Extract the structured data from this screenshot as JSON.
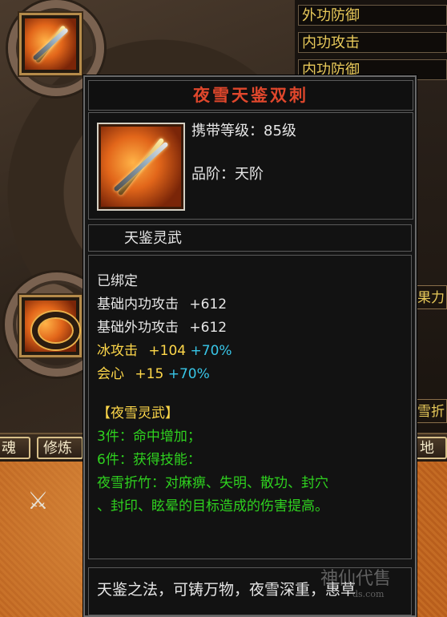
{
  "background": {
    "stat_rows": [
      "外功防御",
      "内功攻击",
      "内功防御"
    ],
    "right_tab_top": "果力",
    "right_tab_mid": "雪折",
    "right_tab_bottom": "地",
    "bottom_tabs": [
      "魂",
      "修炼"
    ]
  },
  "tooltip": {
    "title": "夜雪天鉴双刺",
    "carry_level": "携带等级：85级",
    "grade": "品阶：天阶",
    "category": "天鉴灵武",
    "bound": "已绑定",
    "stats": [
      {
        "label": "基础内功攻击",
        "value": "+612",
        "extra": ""
      },
      {
        "label": "基础外功攻击",
        "value": "+612",
        "extra": ""
      },
      {
        "label": "冰攻击",
        "value": "+104",
        "extra": "+70%"
      },
      {
        "label": "会心",
        "value": "+15",
        "extra": "+70%"
      }
    ],
    "set_name": "【夜雪灵武】",
    "set_bonus_3": "3件：命中增加；",
    "set_bonus_6": "6件：获得技能：",
    "skill_line1": "夜雪折竹：对麻痹、失明、散功、封穴",
    "skill_line2": "、封印、眩晕的目标造成的伤害提高。",
    "description": "天鉴之法，可铸万物，夜雪深重，惠草"
  },
  "watermark": {
    "text": "神仙代售",
    "sub": "ds.com"
  },
  "colors": {
    "title_red": "#e0472c",
    "stat_yellow": "#ffd84a",
    "percent_cyan": "#38c6e8",
    "set_green": "#2fd21f"
  }
}
